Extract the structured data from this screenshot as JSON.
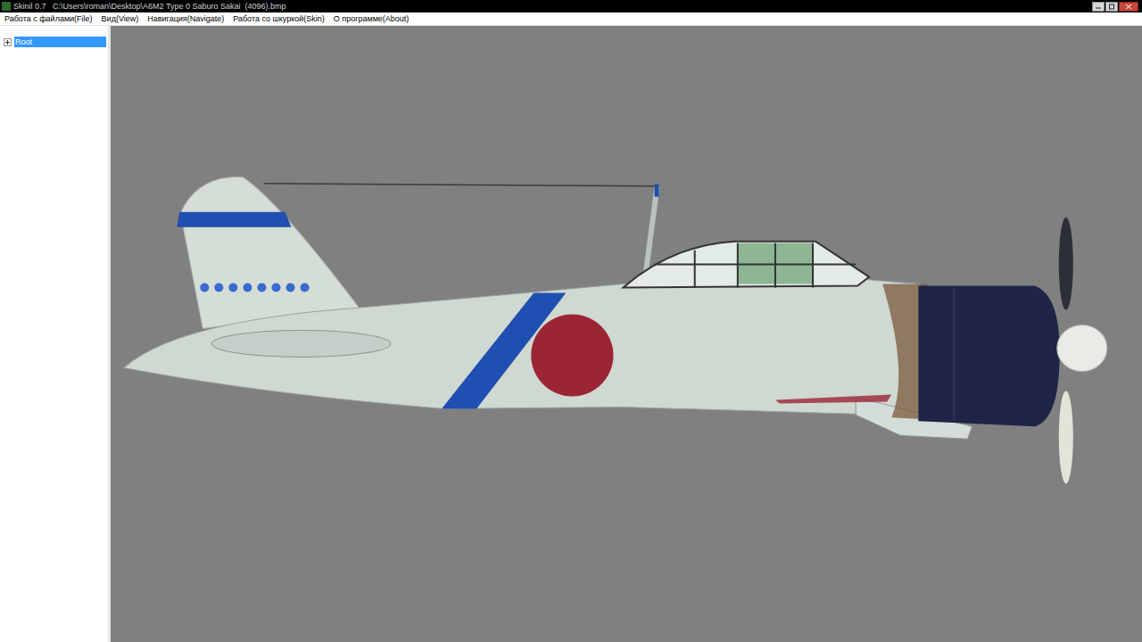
{
  "window": {
    "title": "Skinil 0.7   C:\\Users\\roman\\Desktop\\A6M2 Type 0 Saburo Sakai  (4096).bmp"
  },
  "menu": [
    "Работа с файлами(File)",
    "Вид(View)",
    "Навигация(Navigate)",
    "Работа со шкуркой(Skin)",
    "О программе(About)"
  ],
  "tree": [
    {
      "label": "Root",
      "selected": true,
      "expanded": false
    }
  ]
}
